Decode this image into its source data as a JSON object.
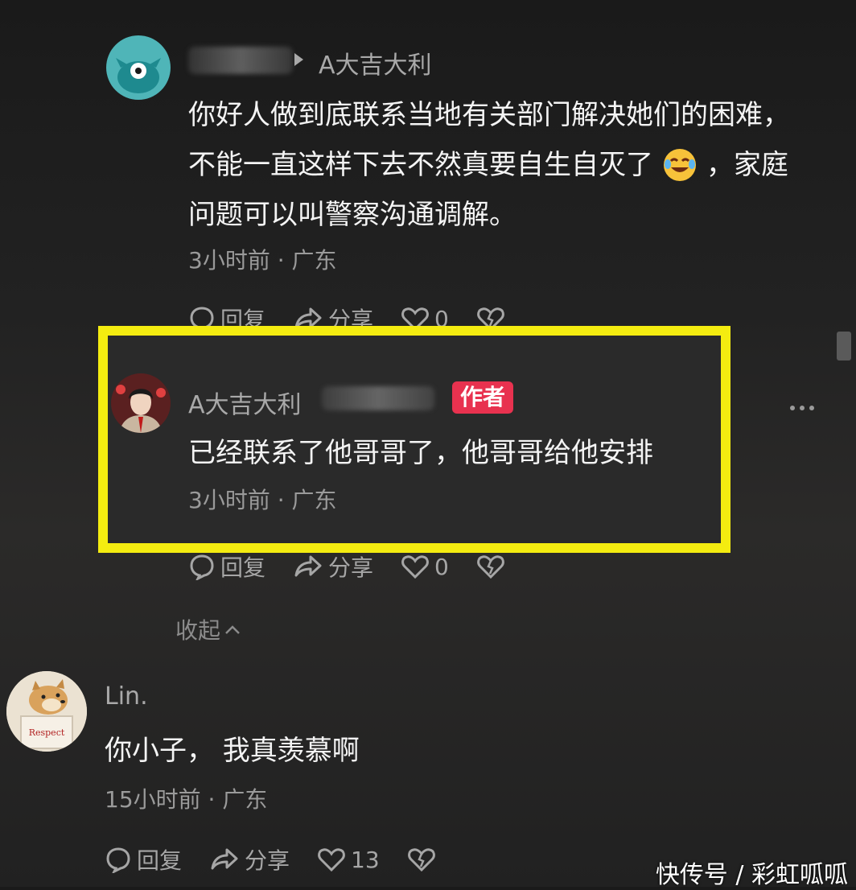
{
  "comments": [
    {
      "reply_to": "A大吉大利",
      "text_lines": [
        "你好人做到底联系当地有关部门解决她们的困难，",
        "不能一直这样下去不然真要自生自灭了",
        "，家庭",
        "问题可以叫警察沟通调解。"
      ],
      "meta": "3小时前 · 广东",
      "actions": {
        "reply": "回复",
        "share": "分享",
        "likes": "0"
      }
    },
    {
      "username": "A大吉大利",
      "author_badge": "作者",
      "text": "已经联系了他哥哥了，他哥哥给他安排",
      "meta": "3小时前 · 广东",
      "actions": {
        "reply": "回复",
        "share": "分享",
        "likes": "0"
      }
    },
    {
      "username": "Lin.",
      "text": "你小子， 我真羡慕啊",
      "meta": "15小时前 · 广东",
      "actions": {
        "reply": "回复",
        "share": "分享",
        "likes": "13"
      }
    }
  ],
  "collapse_label": "收起",
  "avatar3_text": "Respect",
  "watermark": "快传号 / 彩虹呱呱",
  "colors": {
    "highlight": "#f4ec10",
    "badge": "#e8324f"
  }
}
